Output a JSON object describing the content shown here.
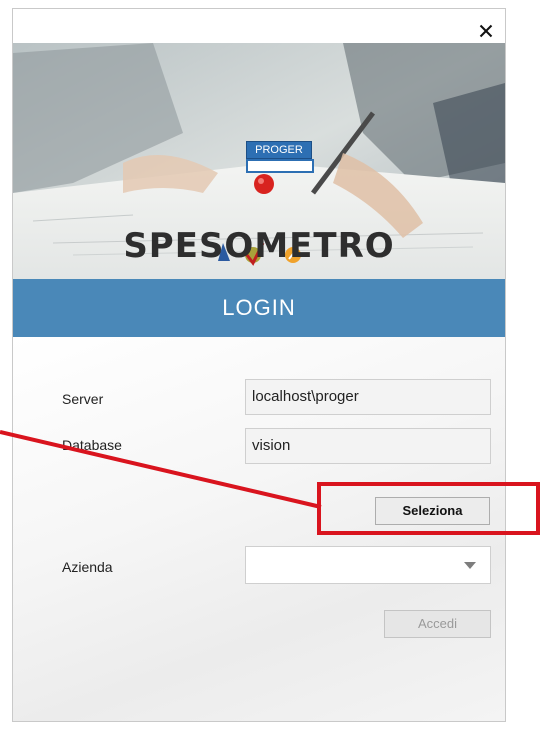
{
  "window": {
    "close_label": "×"
  },
  "banner": {
    "logo_text": "PROGER",
    "product_name": "SPESOMETRO"
  },
  "login_title": "LOGIN",
  "form": {
    "server_label": "Server",
    "server_value": "localhost\\proger",
    "database_label": "Database",
    "database_value": "vision",
    "select_button_label": "Seleziona",
    "azienda_label": "Azienda",
    "azienda_value": "",
    "login_button_label": "Accedi"
  },
  "colors": {
    "accent": "#4a88b8",
    "annotation": "#d9141e"
  }
}
